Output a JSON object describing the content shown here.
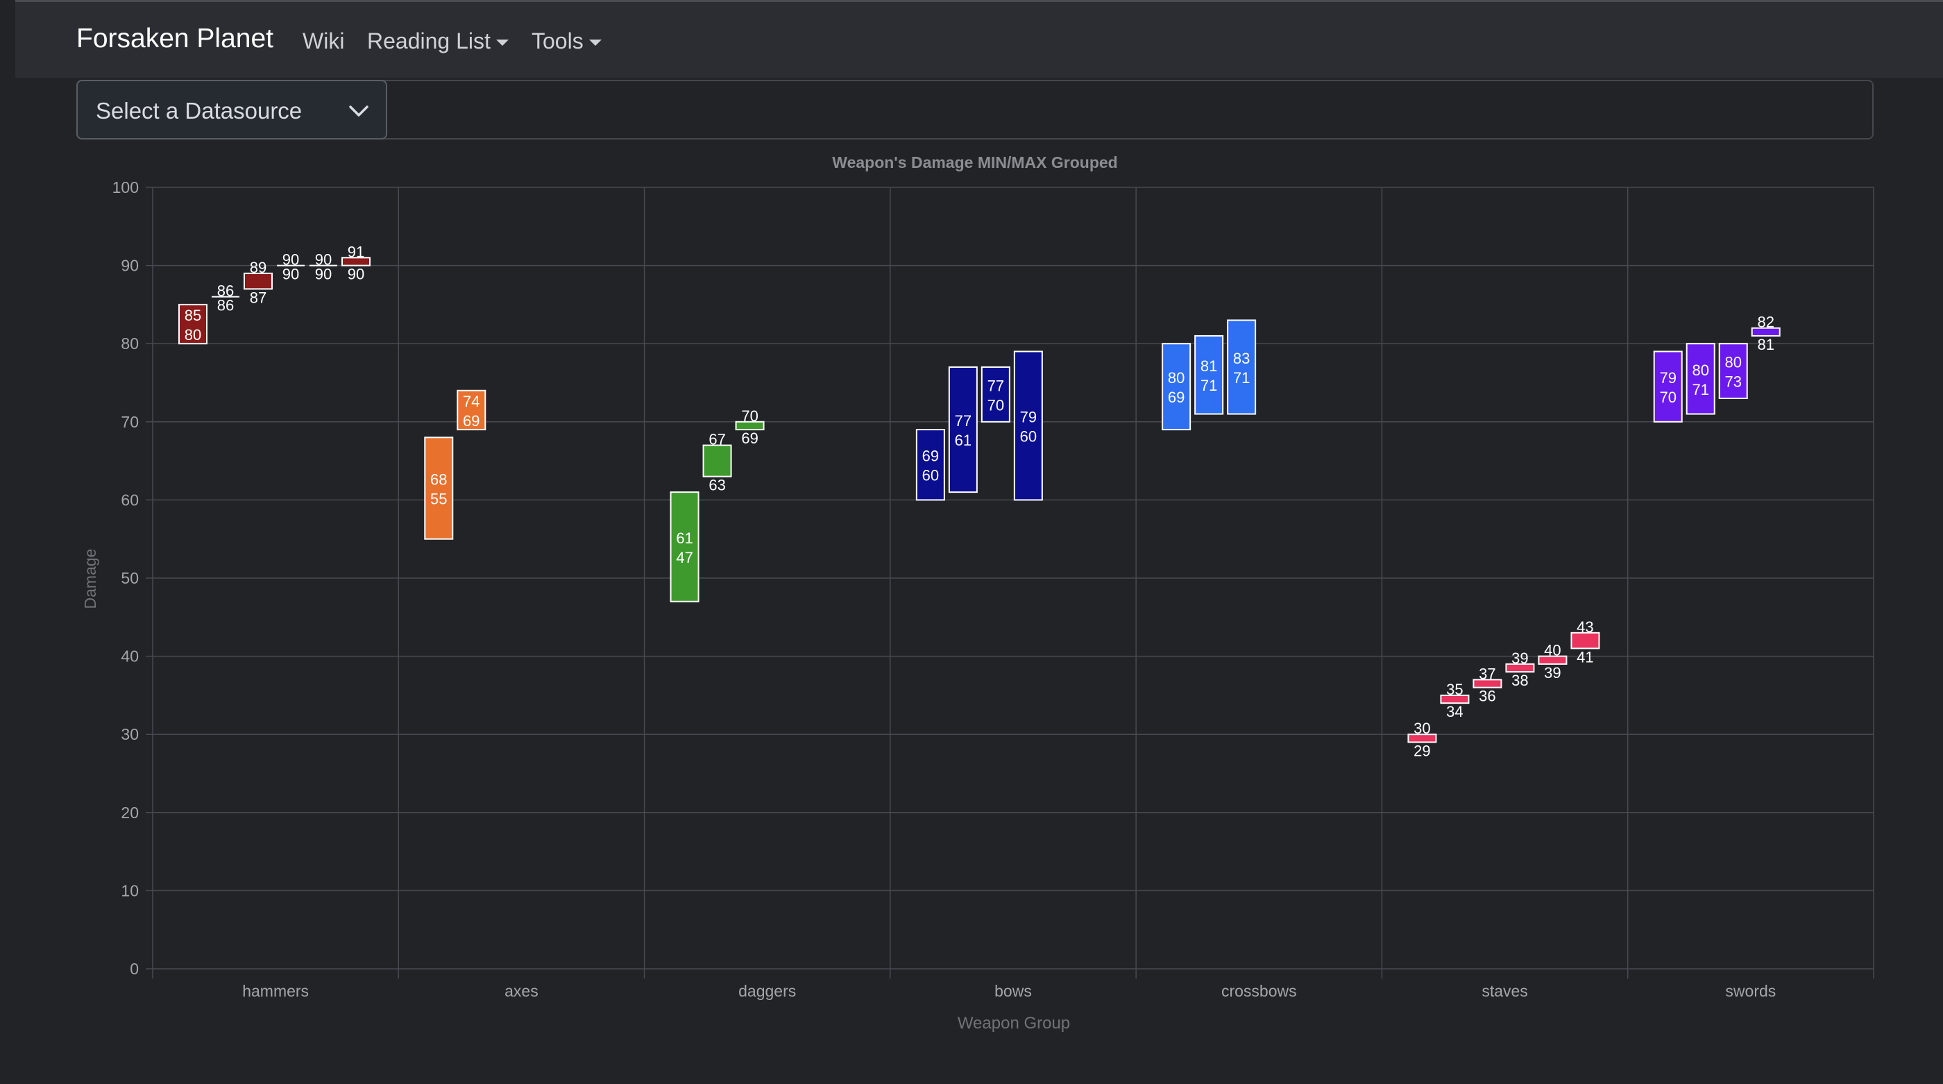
{
  "navbar": {
    "brand": "Forsaken Planet",
    "items": [
      {
        "label": "Wiki",
        "dropdown": false
      },
      {
        "label": "Reading List",
        "dropdown": true
      },
      {
        "label": "Tools",
        "dropdown": true
      }
    ]
  },
  "datasource": {
    "label": "Select a Datasource",
    "icon": "chevron-down-icon"
  },
  "chart_data": {
    "type": "floating-bar",
    "title": "Weapon's Damage MIN/MAX Grouped",
    "xlabel": "Weapon Group",
    "ylabel": "Damage",
    "ylim": [
      0,
      100
    ],
    "yticks": [
      0,
      10,
      20,
      30,
      40,
      50,
      60,
      70,
      80,
      90,
      100
    ],
    "grid": true,
    "categories": [
      "hammers",
      "axes",
      "daggers",
      "bows",
      "crossbows",
      "staves",
      "swords"
    ],
    "groups": [
      {
        "category": "hammers",
        "color": "#8b1a1a",
        "ranges": [
          [
            80,
            85
          ],
          [
            86,
            86
          ],
          [
            87,
            89
          ],
          [
            90,
            90
          ],
          [
            90,
            90
          ],
          [
            90,
            91
          ]
        ]
      },
      {
        "category": "axes",
        "color": "#e8712d",
        "ranges": [
          [
            55,
            68
          ],
          [
            69,
            74
          ]
        ]
      },
      {
        "category": "daggers",
        "color": "#3e9a2c",
        "ranges": [
          [
            47,
            61
          ],
          [
            63,
            67
          ],
          [
            69,
            70
          ]
        ]
      },
      {
        "category": "bows",
        "color": "#0a0e8f",
        "ranges": [
          [
            60,
            69
          ],
          [
            61,
            77
          ],
          [
            70,
            77
          ],
          [
            60,
            79
          ]
        ]
      },
      {
        "category": "crossbows",
        "color": "#2f6ff2",
        "ranges": [
          [
            69,
            80
          ],
          [
            71,
            81
          ],
          [
            71,
            83
          ]
        ]
      },
      {
        "category": "staves",
        "color": "#e8345f",
        "ranges": [
          [
            29,
            30
          ],
          [
            34,
            35
          ],
          [
            36,
            37
          ],
          [
            38,
            39
          ],
          [
            39,
            40
          ],
          [
            41,
            43
          ]
        ]
      },
      {
        "category": "swords",
        "color": "#6a1aed",
        "ranges": [
          [
            70,
            79
          ],
          [
            71,
            80
          ],
          [
            73,
            80
          ],
          [
            81,
            82
          ]
        ]
      }
    ]
  }
}
